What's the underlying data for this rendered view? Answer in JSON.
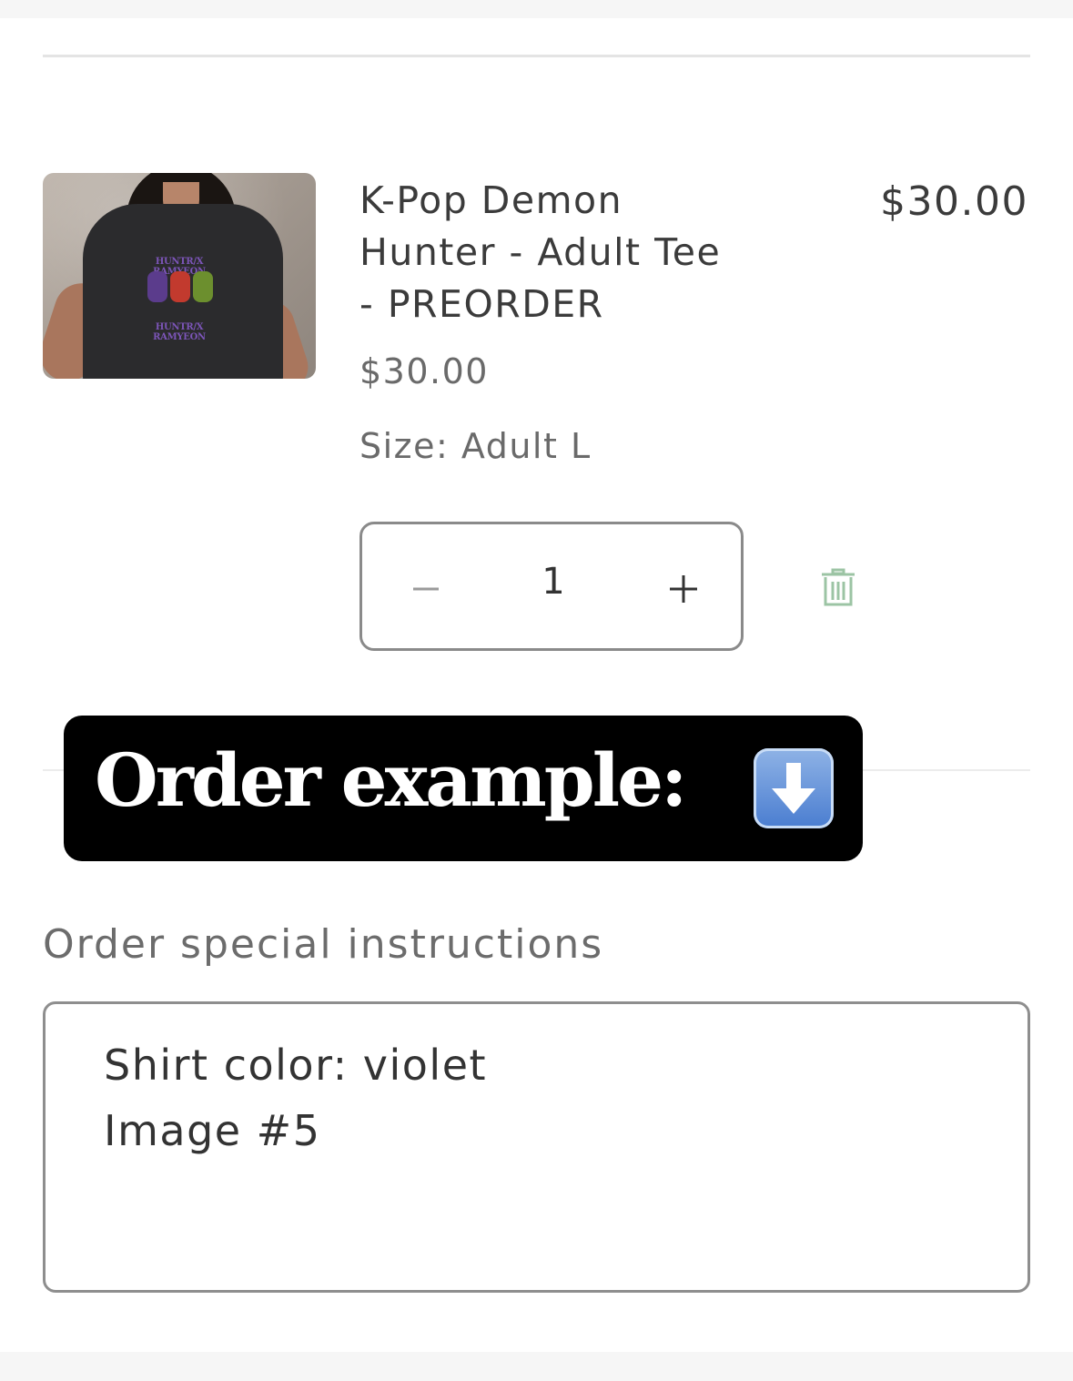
{
  "cart_item": {
    "title_lines": [
      "K-Pop Demon",
      "Hunter - Adult Tee",
      "- PREORDER"
    ],
    "line_price": "$30.00",
    "unit_price": "$30.00",
    "size_label": "Size: Adult L",
    "quantity": "1",
    "image_print_lines": [
      "HUNTR/X RAMYEON",
      "HUNTR/X RAMYEON"
    ]
  },
  "overlay": {
    "text": "Order example:",
    "emoji": "down-arrow-emoji"
  },
  "notes": {
    "label": "Order special instructions",
    "lines": [
      "Shirt color: violet",
      "Image #5"
    ]
  },
  "colors": {
    "trash_icon": "#9cc4a4",
    "overlay_background": "#000000",
    "print_purple": "#7c55b8"
  }
}
